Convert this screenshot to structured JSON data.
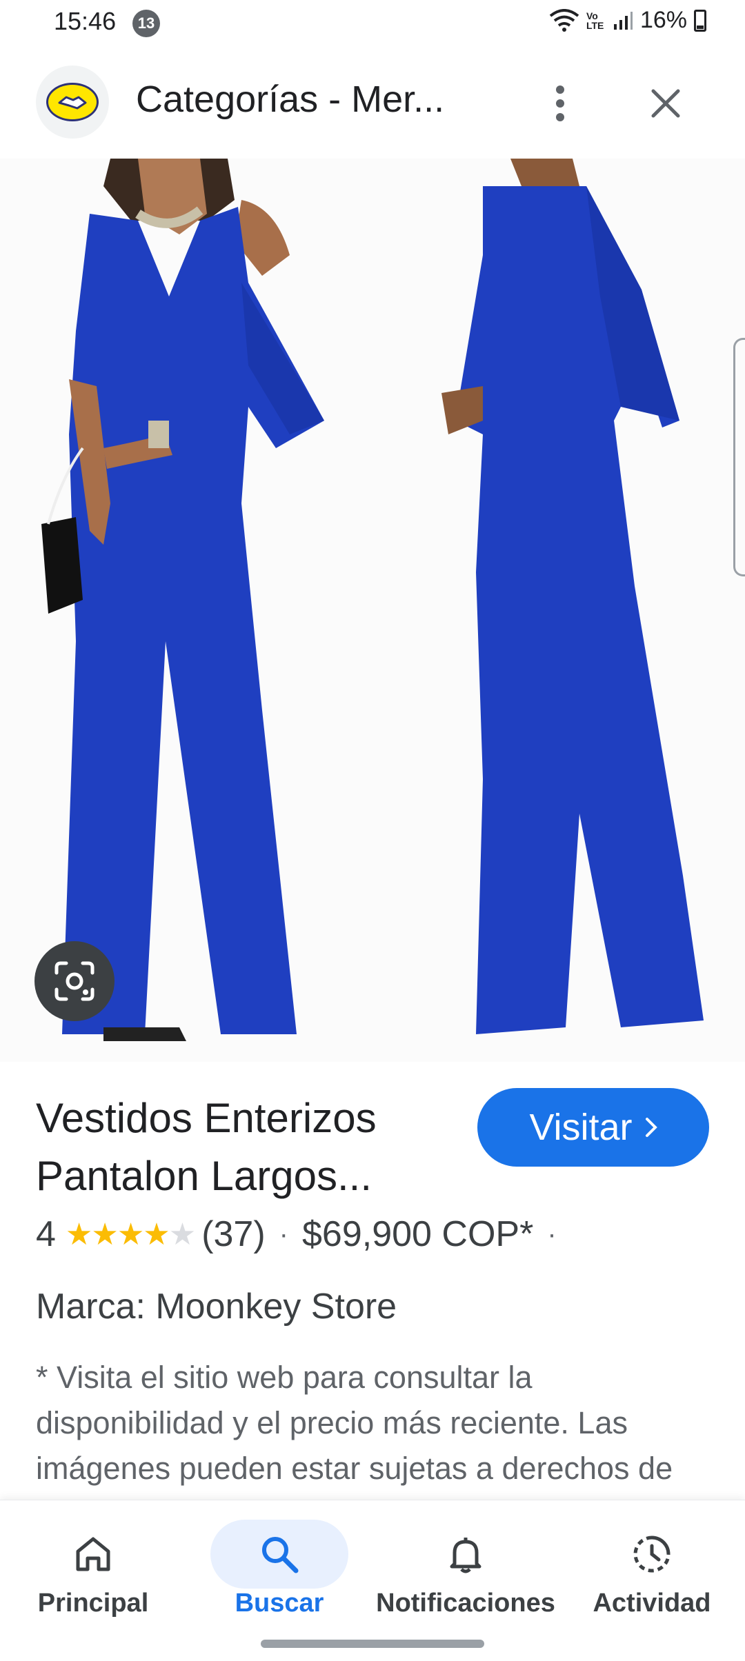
{
  "status_bar": {
    "time": "15:46",
    "notification_count": "13",
    "network": "Vo LTE",
    "battery": "16%"
  },
  "app_bar": {
    "title": "Categorías - Mer..."
  },
  "product": {
    "title": "Vestidos Enterizos Pantalon Largos...",
    "visit_label": "Visitar",
    "rating": "4",
    "stars_filled": 4,
    "stars_total": 5,
    "review_count": "(37)",
    "price": "$69,900 COP*",
    "brand": "Marca: Moonkey Store",
    "disclaimer": "* Visita el sitio web para consultar la disponibilidad y el precio más reciente. Las imágenes pueden estar sujetas a derechos de autor. Más información"
  },
  "bottom_nav": {
    "items": [
      {
        "label": "Principal",
        "icon": "home-icon"
      },
      {
        "label": "Buscar",
        "icon": "search-icon",
        "active": true
      },
      {
        "label": "Notificaciones",
        "icon": "bell-icon"
      },
      {
        "label": "Actividad",
        "icon": "activity-icon"
      }
    ]
  },
  "colors": {
    "accent": "#1a73e8",
    "garment": "#1f3fc0",
    "star": "#fbbc04"
  }
}
